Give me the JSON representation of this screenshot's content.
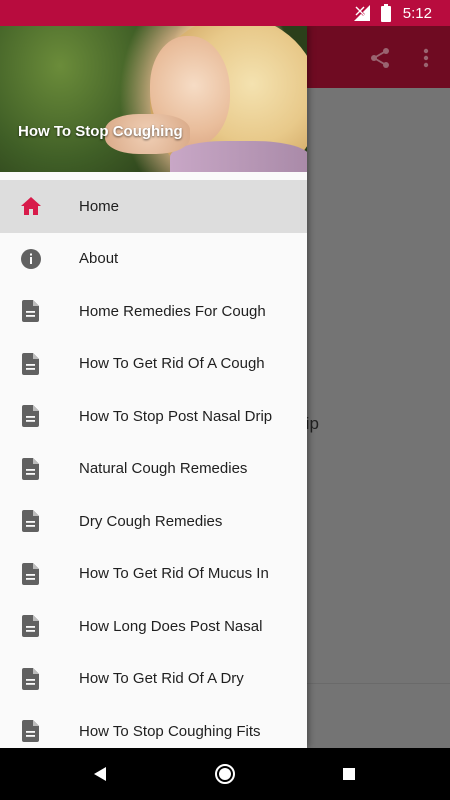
{
  "status_bar": {
    "time": "5:12",
    "icons": [
      "signal-off-icon",
      "battery-icon"
    ]
  },
  "app_bar": {
    "actions": [
      "share-icon",
      "more-vert-icon"
    ]
  },
  "background_content": {
    "fragment": "rip"
  },
  "drawer": {
    "header_title": "How To Stop Coughing",
    "items": [
      {
        "label": "Home",
        "icon": "home-icon",
        "active": true
      },
      {
        "label": "About",
        "icon": "info-icon",
        "active": false
      },
      {
        "label": "Home Remedies For Cough",
        "icon": "document-icon",
        "active": false
      },
      {
        "label": "How To Get Rid Of A Cough",
        "icon": "document-icon",
        "active": false
      },
      {
        "label": "How To Stop Post Nasal Drip",
        "icon": "document-icon",
        "active": false
      },
      {
        "label": "Natural Cough Remedies",
        "icon": "document-icon",
        "active": false
      },
      {
        "label": "Dry Cough Remedies",
        "icon": "document-icon",
        "active": false
      },
      {
        "label": "How To Get Rid Of Mucus In",
        "icon": "document-icon",
        "active": false
      },
      {
        "label": "How Long Does Post Nasal",
        "icon": "document-icon",
        "active": false
      },
      {
        "label": "How To Get Rid Of A Dry",
        "icon": "document-icon",
        "active": false
      },
      {
        "label": "How To Stop Coughing Fits",
        "icon": "document-icon",
        "active": false
      }
    ]
  },
  "nav_bar": {
    "buttons": [
      "back-icon",
      "home-circle-icon",
      "recents-icon"
    ]
  },
  "colors": {
    "status_bar": "#b80c3e",
    "accent": "#d81b4a",
    "icon_gray": "#616161"
  }
}
